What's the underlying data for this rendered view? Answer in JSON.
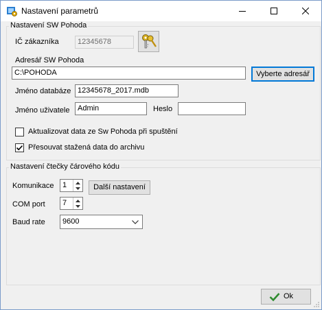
{
  "window": {
    "title": "Nastavení parametrů"
  },
  "pohoda": {
    "legend": "Nastavení SW Pohoda",
    "ic_label": "IČ zákazníka",
    "ic_value": "12345678",
    "dir_label": "Adresář SW Pohoda",
    "dir_value": "C:\\POHODA",
    "dir_button": "Vyberte adresář",
    "db_label": "Jméno databáze",
    "db_value": "12345678_2017.mdb",
    "user_label": "Jméno uživatele",
    "user_value": "Admin",
    "password_label": "Heslo",
    "password_value": "",
    "update_checkbox_label": "Aktualizovat data ze Sw Pohoda při spuštění",
    "update_checked": false,
    "archive_checkbox_label": "Přesouvat stažená data do archivu",
    "archive_checked": true
  },
  "reader": {
    "legend": "Nastavení čtečky čárového kódu",
    "comm_label": "Komunikace",
    "comm_value": "1",
    "more_button": "Další nastavení",
    "port_label": "COM port",
    "port_value": "7",
    "baud_label": "Baud rate",
    "baud_value": "9600"
  },
  "footer": {
    "ok_label": "Ok"
  }
}
